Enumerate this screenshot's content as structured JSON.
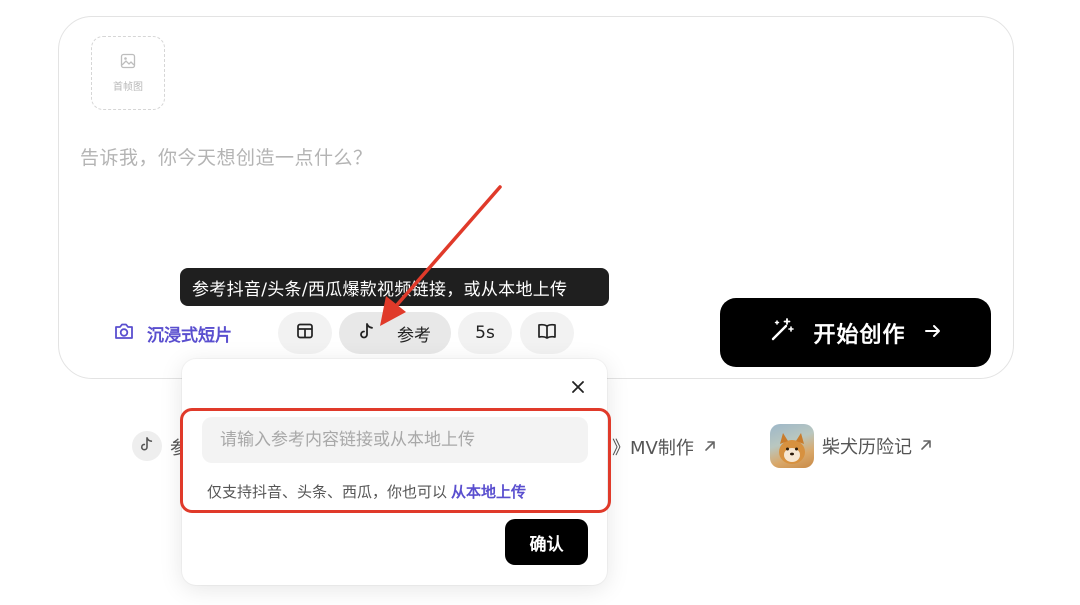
{
  "composer": {
    "first_frame_label": "首帧图",
    "prompt_placeholder": "告诉我，你今天想创造一点什么？"
  },
  "tooltip": {
    "text": "参考抖音/头条/西瓜爆款视频链接，或从本地上传"
  },
  "toolbar": {
    "mode_label": "沉浸式短片",
    "reference_label": "参考",
    "duration_label": "5s",
    "start_button_label": "开始创作"
  },
  "suggestions": {
    "ref_chip_label": "参",
    "mv_chip_label": "》MV制作",
    "shiba_chip_label": "柴犬历险记"
  },
  "popover": {
    "input_placeholder": "请输入参考内容链接或从本地上传",
    "input_value": "",
    "hint_text": "仅支持抖音、头条、西瓜，你也可以",
    "upload_link_label": "从本地上传",
    "confirm_label": "确认"
  },
  "colors": {
    "accent": "#5a4fcf",
    "annotation_red": "#e03a2a",
    "primary_button": "#000000"
  },
  "icons": {
    "first_frame": "image-icon",
    "mode": "camera-icon",
    "layout": "layout-icon",
    "reference": "tiktok-icon",
    "book": "book-icon",
    "start": "magic-wand-icon",
    "start_arrow": "arrow-right-icon",
    "close": "close-icon"
  }
}
